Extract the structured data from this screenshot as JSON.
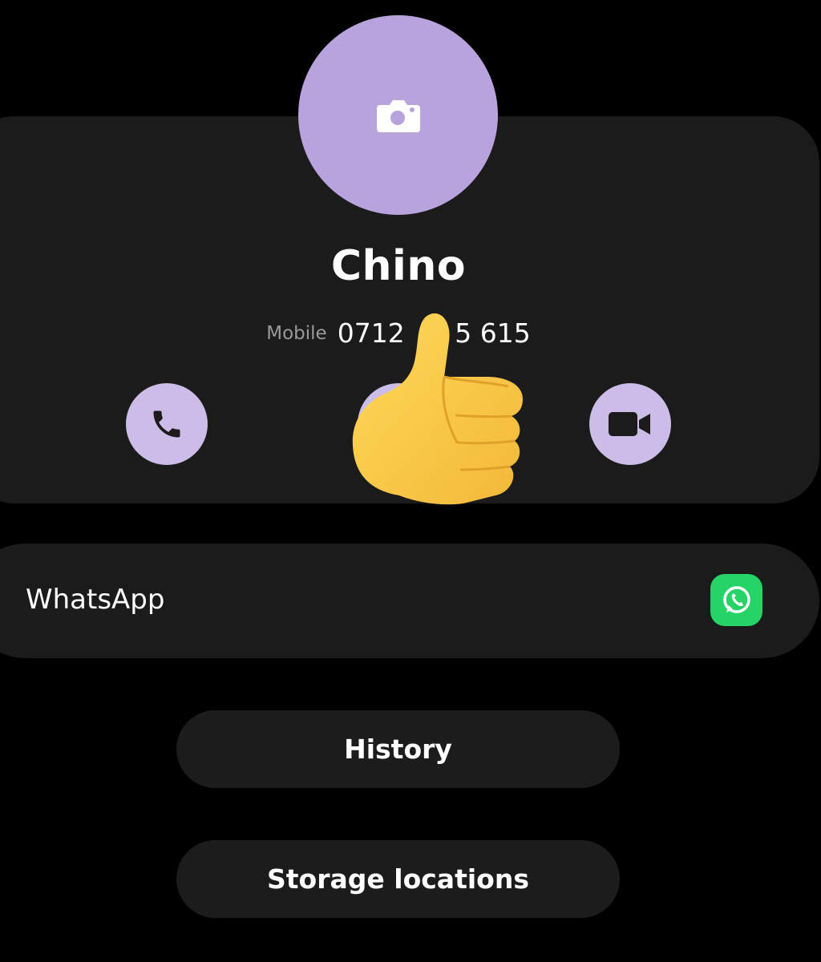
{
  "contact": {
    "name": "Chino",
    "phone_type": "Mobile",
    "phone_number": "0712 ",
    "phone_number_suffix": "5 615"
  },
  "avatar": {
    "icon": "camera-icon",
    "color": "#b8a3dc"
  },
  "actions": [
    {
      "name": "call",
      "icon": "phone-icon"
    },
    {
      "name": "message",
      "icon": "message-icon"
    },
    {
      "name": "video-call",
      "icon": "video-icon"
    }
  ],
  "overlay": {
    "icon": "thumbs-up-icon"
  },
  "whatsapp": {
    "label": "WhatsApp",
    "icon": "whatsapp-icon",
    "color": "#25d366"
  },
  "buttons": {
    "history": "History",
    "storage": "Storage locations"
  }
}
